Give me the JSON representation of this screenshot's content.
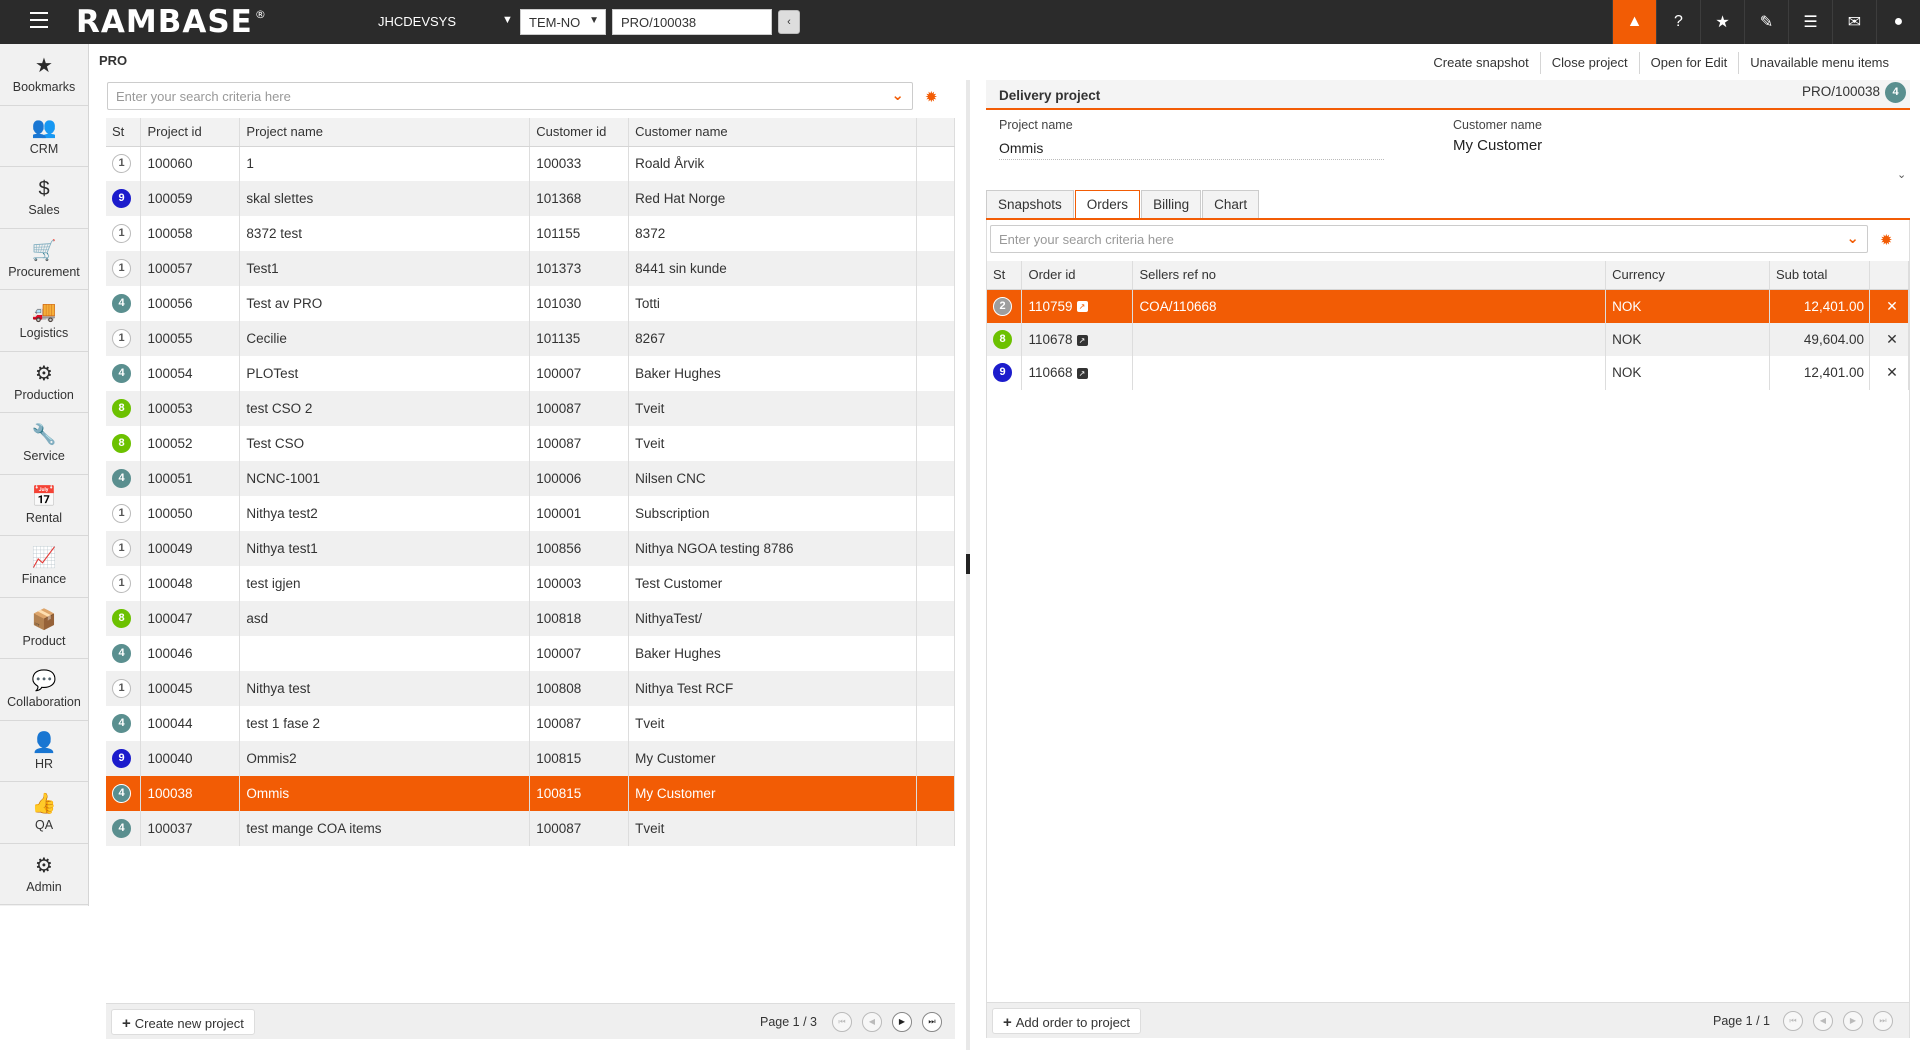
{
  "topbar": {
    "logo": "RAMBASE",
    "logo_mark": "®",
    "system": "JHCDEVSYS",
    "company": "TEM-NO",
    "goto_value": "PRO/100038",
    "icons": [
      "alert-icon",
      "help-icon",
      "star-icon",
      "paperclip-icon",
      "list-icon",
      "mail-icon",
      "user-icon"
    ]
  },
  "sidebar": {
    "items": [
      {
        "label": "Bookmarks",
        "icon": "★"
      },
      {
        "label": "CRM",
        "icon": "👥"
      },
      {
        "label": "Sales",
        "icon": "$"
      },
      {
        "label": "Procurement",
        "icon": "🛒"
      },
      {
        "label": "Logistics",
        "icon": "🚚"
      },
      {
        "label": "Production",
        "icon": "⚙"
      },
      {
        "label": "Service",
        "icon": "🔧"
      },
      {
        "label": "Rental",
        "icon": "📅"
      },
      {
        "label": "Finance",
        "icon": "📈"
      },
      {
        "label": "Product",
        "icon": "📦"
      },
      {
        "label": "Collaboration",
        "icon": "💬"
      },
      {
        "label": "HR",
        "icon": "👤"
      },
      {
        "label": "QA",
        "icon": "👍"
      },
      {
        "label": "Admin",
        "icon": "⚙"
      }
    ]
  },
  "left": {
    "title": "PRO",
    "search_placeholder": "Enter your search criteria here",
    "columns": [
      "St",
      "Project id",
      "Project name",
      "Customer id",
      "Customer name"
    ],
    "rows": [
      {
        "st": "1",
        "id": "100060",
        "name": "1",
        "cid": "100033",
        "cname": "Roald Årvik"
      },
      {
        "st": "9",
        "id": "100059",
        "name": "skal slettes",
        "cid": "101368",
        "cname": "Red Hat Norge"
      },
      {
        "st": "1",
        "id": "100058",
        "name": "8372 test",
        "cid": "101155",
        "cname": "8372"
      },
      {
        "st": "1",
        "id": "100057",
        "name": "Test1",
        "cid": "101373",
        "cname": "8441 sin kunde"
      },
      {
        "st": "4",
        "id": "100056",
        "name": "Test av PRO",
        "cid": "101030",
        "cname": "Totti"
      },
      {
        "st": "1",
        "id": "100055",
        "name": "Cecilie",
        "cid": "101135",
        "cname": "8267"
      },
      {
        "st": "4",
        "id": "100054",
        "name": "PLOTest",
        "cid": "100007",
        "cname": "Baker Hughes"
      },
      {
        "st": "8",
        "id": "100053",
        "name": "test CSO 2",
        "cid": "100087",
        "cname": "Tveit"
      },
      {
        "st": "8",
        "id": "100052",
        "name": "Test CSO",
        "cid": "100087",
        "cname": "Tveit"
      },
      {
        "st": "4",
        "id": "100051",
        "name": "NCNC-1001",
        "cid": "100006",
        "cname": "Nilsen CNC"
      },
      {
        "st": "1",
        "id": "100050",
        "name": "Nithya test2",
        "cid": "100001",
        "cname": "Subscription"
      },
      {
        "st": "1",
        "id": "100049",
        "name": "Nithya test1",
        "cid": "100856",
        "cname": "Nithya NGOA testing 8786"
      },
      {
        "st": "1",
        "id": "100048",
        "name": "test igjen",
        "cid": "100003",
        "cname": "Test Customer"
      },
      {
        "st": "8",
        "id": "100047",
        "name": "asd",
        "cid": "100818",
        "cname": "NithyaTest/"
      },
      {
        "st": "4",
        "id": "100046",
        "name": "",
        "cid": "100007",
        "cname": "Baker Hughes"
      },
      {
        "st": "1",
        "id": "100045",
        "name": "Nithya test",
        "cid": "100808",
        "cname": "Nithya Test RCF"
      },
      {
        "st": "4",
        "id": "100044",
        "name": "test 1 fase 2",
        "cid": "100087",
        "cname": "Tveit"
      },
      {
        "st": "9",
        "id": "100040",
        "name": "Ommis2",
        "cid": "100815",
        "cname": "My Customer"
      },
      {
        "st": "4",
        "id": "100038",
        "name": "Ommis",
        "cid": "100815",
        "cname": "My Customer",
        "selected": true
      },
      {
        "st": "4",
        "id": "100037",
        "name": "test mange COA items",
        "cid": "100087",
        "cname": "Tveit"
      }
    ],
    "create_label": "Create new project",
    "pager": "Page 1 / 3"
  },
  "right": {
    "menu": [
      "Create snapshot",
      "Close project",
      "Open for Edit",
      "Unavailable menu items"
    ],
    "header_title": "Delivery project",
    "header_id": "PRO/100038",
    "header_status": "4",
    "project_name_label": "Project name",
    "project_name": "Ommis",
    "customer_name_label": "Customer name",
    "customer_name": "My Customer",
    "tabs": [
      "Snapshots",
      "Orders",
      "Billing",
      "Chart"
    ],
    "active_tab": "Orders",
    "search_placeholder": "Enter your search criteria here",
    "columns": [
      "St",
      "Order id",
      "Sellers ref no",
      "Currency",
      "Sub total"
    ],
    "rows": [
      {
        "st": "2",
        "id": "110759",
        "ref": "COA/110668",
        "cur": "NOK",
        "total": "12,401.00",
        "selected": true
      },
      {
        "st": "8",
        "id": "110678",
        "ref": "",
        "cur": "NOK",
        "total": "49,604.00"
      },
      {
        "st": "9",
        "id": "110668",
        "ref": "",
        "cur": "NOK",
        "total": "12,401.00"
      }
    ],
    "add_label": "Add order to project",
    "pager": "Page 1 / 1"
  },
  "colors": {
    "accent": "#f25c05",
    "status_1": "#888888",
    "status_2": "#9e9e9e",
    "status_4": "#5a8f8f",
    "status_8": "#6cc100",
    "status_9": "#1c1ccc"
  }
}
